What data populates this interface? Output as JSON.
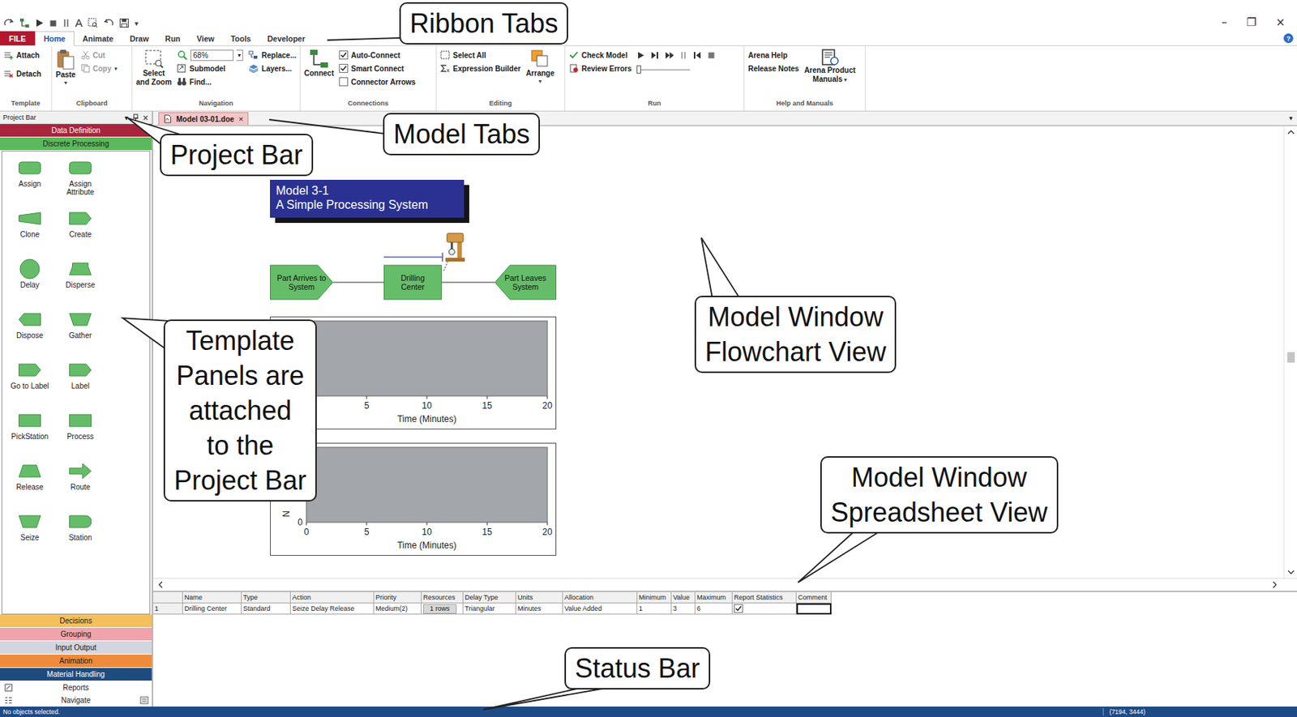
{
  "quick_access": {
    "text_tool": "A",
    "customize": "▾"
  },
  "window_controls": [
    "–",
    "❐",
    "×"
  ],
  "help_button": "?",
  "ribbon_tabs": [
    {
      "label": "FILE",
      "kind": "file",
      "selected": false
    },
    {
      "label": "Home",
      "kind": "tab",
      "selected": true
    },
    {
      "label": "Animate",
      "kind": "tab",
      "selected": false
    },
    {
      "label": "Draw",
      "kind": "tab",
      "selected": false
    },
    {
      "label": "Run",
      "kind": "tab",
      "selected": false
    },
    {
      "label": "View",
      "kind": "tab",
      "selected": false
    },
    {
      "label": "Tools",
      "kind": "tab",
      "selected": false
    },
    {
      "label": "Developer",
      "kind": "tab",
      "selected": false
    }
  ],
  "ribbon": {
    "template": {
      "label": "Template",
      "attach": "Attach",
      "detach": "Detach"
    },
    "clipboard": {
      "label": "Clipboard",
      "paste": "Paste",
      "paste_arrow": "▾",
      "cut": {
        "label": "Cut",
        "disabled": true
      },
      "copy": {
        "label": "Copy",
        "disabled": true
      },
      "copy_arrow": "▾"
    },
    "navigation": {
      "label": "Navigation",
      "select_zoom": [
        "Select",
        "and Zoom"
      ],
      "zoom": "68%",
      "zoom_arrow": "▾",
      "submodel": "Submodel",
      "find": "Find...",
      "replace": "Replace...",
      "layers": "Layers..."
    },
    "connections": {
      "label": "Connections",
      "connect": "Connect",
      "options": [
        {
          "label": "Auto-Connect",
          "checked": true
        },
        {
          "label": "Smart Connect",
          "checked": true
        },
        {
          "label": "Connector Arrows",
          "checked": false
        }
      ]
    },
    "editing": {
      "label": "Editing",
      "select_all": "Select All",
      "expression_builder": "Expression Builder",
      "arrange": "Arrange",
      "arrange_arrow": "▾"
    },
    "run": {
      "label": "Run",
      "check_model": "Check Model",
      "review_errors": "Review Errors",
      "speed_level": 0.0
    },
    "help": {
      "label": "Help and Manuals",
      "arena_help": "Arena Help",
      "release_notes": "Release Notes",
      "manuals": [
        "Arena Product",
        "Manuals"
      ],
      "manuals_arrow": "▾"
    }
  },
  "project_bar": {
    "title": "Project Bar",
    "controls": [
      "▾",
      "×"
    ],
    "panels": [
      {
        "label": "Data Definition",
        "color": "#a8253d",
        "expanded": false
      },
      {
        "label": "Discrete Processing",
        "color": "#5cb85c",
        "expanded": true
      },
      {
        "label": "Decisions",
        "color": "#f5bf5a",
        "expanded": false
      },
      {
        "label": "Grouping",
        "color": "#f1a3ab",
        "expanded": false
      },
      {
        "label": "Input Output",
        "color": "#d3d6de",
        "expanded": false
      },
      {
        "label": "Animation",
        "color": "#ef8b3c",
        "expanded": false
      },
      {
        "label": "Material Handling",
        "color": "#1f4c7e",
        "expanded": false
      }
    ],
    "modules": [
      {
        "label": "Assign",
        "kind": "rounded"
      },
      {
        "label": "Assign Attribute",
        "kind": "rounded"
      },
      {
        "label": "Clone",
        "kind": "flag"
      },
      {
        "label": "Create",
        "kind": "pentagon"
      },
      {
        "label": "Delay",
        "kind": "circle"
      },
      {
        "label": "Disperse",
        "kind": "disperse"
      },
      {
        "label": "Dispose",
        "kind": "point-left"
      },
      {
        "label": "Gather",
        "kind": "trap-narrow-bottom"
      },
      {
        "label": "Go to Label",
        "kind": "pentagon"
      },
      {
        "label": "Label",
        "kind": "pentagon"
      },
      {
        "label": "PickStation",
        "kind": "rect"
      },
      {
        "label": "Process",
        "kind": "rect"
      },
      {
        "label": "Release",
        "kind": "trap-narrow-top"
      },
      {
        "label": "Route",
        "kind": "arrow"
      },
      {
        "label": "Seize",
        "kind": "trap-narrow-bottom"
      },
      {
        "label": "Station",
        "kind": "d-shape"
      }
    ],
    "nav_items": [
      "Reports",
      "Navigate"
    ]
  },
  "model_tabs": [
    {
      "label": "Model 03-01.doe",
      "close": "×",
      "selected": true
    }
  ],
  "model_tabs_menu": "▾",
  "flowchart": {
    "title_lines": [
      "Model 3-1",
      "A Simple Processing System"
    ],
    "modules": [
      {
        "label": "Part Arrives to System",
        "kind": "pentagon"
      },
      {
        "label": "Drilling Center",
        "kind": "rect"
      },
      {
        "label": "Part Leaves System",
        "kind": "point-left"
      }
    ],
    "plots": [
      {
        "x_ticks": [
          "5",
          "10",
          "15",
          "20"
        ],
        "x_label": "Time (Minutes)",
        "y_ticks": [],
        "y_label": ""
      },
      {
        "x_ticks": [
          "0",
          "5",
          "10",
          "15",
          "20"
        ],
        "x_label": "Time (Minutes)",
        "y_ticks": [
          "0"
        ],
        "y_label": "N"
      }
    ]
  },
  "vertical_scroll": {
    "level": 0.5
  },
  "spreadsheet": {
    "columns": [
      {
        "label": "",
        "kind": "rownum"
      },
      {
        "label": "Name",
        "kind": "text"
      },
      {
        "label": "Type",
        "kind": "text"
      },
      {
        "label": "Action",
        "kind": "text"
      },
      {
        "label": "Priority",
        "kind": "text"
      },
      {
        "label": "Resources",
        "kind": "button"
      },
      {
        "label": "Delay Type",
        "kind": "text"
      },
      {
        "label": "Units",
        "kind": "text"
      },
      {
        "label": "Allocation",
        "kind": "text"
      },
      {
        "label": "Minimum",
        "kind": "text"
      },
      {
        "label": "Value",
        "kind": "text"
      },
      {
        "label": "Maximum",
        "kind": "text"
      },
      {
        "label": "Report Statistics",
        "kind": "checkbox"
      },
      {
        "label": "Comment",
        "kind": "text"
      }
    ],
    "rows": [
      {
        "cells": [
          "1",
          "Drilling Center",
          "Standard",
          "Seize Delay Release",
          "Medium(2)",
          "1 rows",
          "Triangular",
          "Minutes",
          "Value Added",
          "1",
          "3",
          "6",
          true,
          ""
        ],
        "selected_cell": "Comment"
      }
    ]
  },
  "status_bar": {
    "text": "No objects selected.",
    "coordinates": "(7194, 3444)"
  },
  "callouts": [
    {
      "lines": [
        "Ribbon Tabs"
      ]
    },
    {
      "lines": [
        "Model Tabs"
      ]
    },
    {
      "lines": [
        "Project Bar"
      ]
    },
    {
      "lines": [
        "Template",
        "Panels are",
        "attached",
        "to the",
        "Project Bar"
      ]
    },
    {
      "lines": [
        "Model Window",
        "Flowchart View"
      ]
    },
    {
      "lines": [
        "Model Window",
        "Spreadsheet View"
      ]
    },
    {
      "lines": [
        "Status Bar"
      ]
    }
  ]
}
